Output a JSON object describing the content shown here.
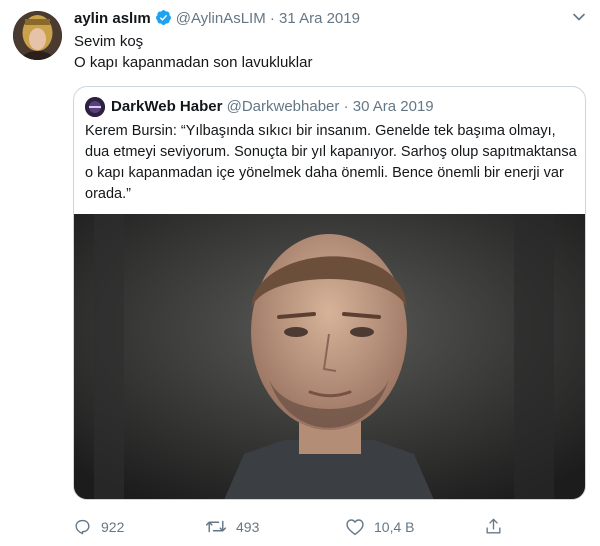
{
  "tweet": {
    "display_name": "aylin aslım",
    "handle": "@AylinAsLIM",
    "separator": "·",
    "date": "31 Ara 2019",
    "lines": [
      "Sevim koş",
      "O kapı kapanmadan son lavukluklar"
    ]
  },
  "quoted": {
    "display_name": "DarkWeb Haber",
    "handle": "@Darkwebhaber",
    "separator": "·",
    "date": "30 Ara 2019",
    "text": "Kerem Bursin: “Yılbaşında sıkıcı bir insanım. Genelde tek başıma olmayı, dua etmeyi seviyorum. Sonuçta bir yıl kapanıyor. Sarhoş olup sapıtmaktansa o kapı kapanmadan içe yönelmek daha önemli. Bence önemli bir enerji var orada.”"
  },
  "actions": {
    "replies": "922",
    "retweets": "493",
    "likes": "10,4 B"
  },
  "colors": {
    "verified_blue": "#1da1f2",
    "secondary_text": "#657786",
    "border": "#ccd6dd"
  },
  "icons": [
    "verified-badge-icon",
    "chevron-down-icon",
    "reply-icon",
    "retweet-icon",
    "like-icon",
    "share-icon"
  ]
}
